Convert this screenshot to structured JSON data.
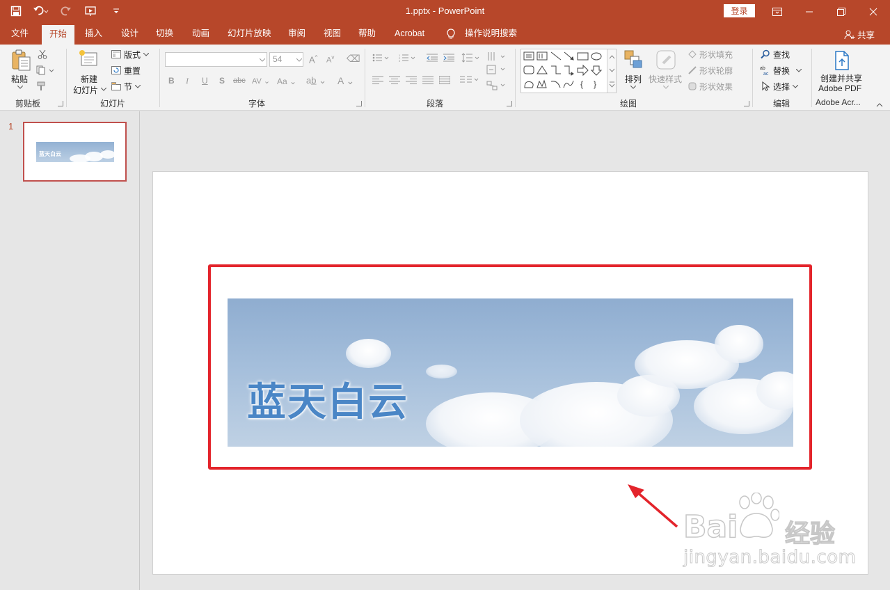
{
  "window": {
    "title": "1.pptx  -  PowerPoint",
    "login_label": "登录"
  },
  "tabs": [
    "文件",
    "开始",
    "插入",
    "设计",
    "切换",
    "动画",
    "幻灯片放映",
    "审阅",
    "视图",
    "帮助",
    "Acrobat",
    "操作说明搜索"
  ],
  "share_label": "共享",
  "ribbon": {
    "clipboard": {
      "paste": "粘贴",
      "group": "剪贴板"
    },
    "slides": {
      "new_line1": "新建",
      "new_line2": "幻灯片",
      "layout": "版式",
      "reset": "重置",
      "section": "节",
      "group": "幻灯片"
    },
    "font": {
      "size": "54",
      "group": "字体"
    },
    "paragraph": {
      "group": "段落"
    },
    "drawing": {
      "arrange": "排列",
      "quick_styles": "快速样式",
      "shape_fill": "形状填充",
      "shape_outline": "形状轮廓",
      "shape_effects": "形状效果",
      "group": "绘图"
    },
    "editing": {
      "find": "查找",
      "replace": "替换",
      "select": "选择",
      "group": "编辑"
    },
    "adobe": {
      "line1": "创建并共享",
      "line2": "Adobe PDF",
      "group": "Adobe Acr..."
    }
  },
  "thumbnails": [
    {
      "number": "1",
      "title": "蓝天白云"
    }
  ],
  "slide": {
    "banner_title": "蓝天白云"
  },
  "watermark": {
    "brand_left": "Bai",
    "brand_right": "经验",
    "url": "jingyan.baidu.com"
  },
  "colors": {
    "accent": "#b7472a",
    "selection": "#e3242b",
    "banner_text": "#4a86c6"
  }
}
